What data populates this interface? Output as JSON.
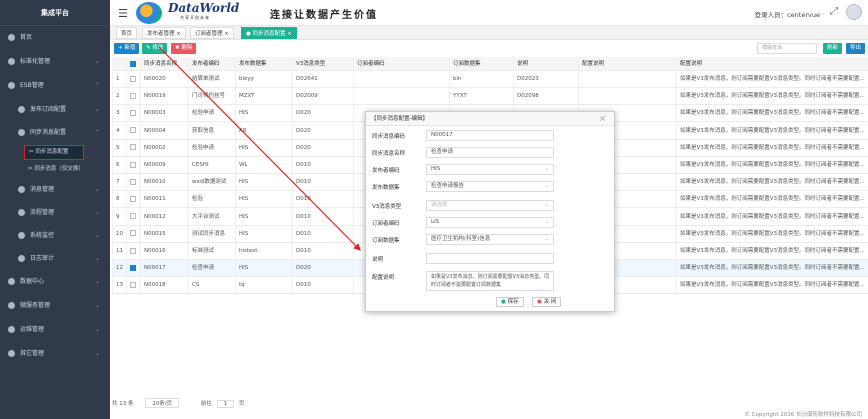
{
  "sidebar": {
    "title": "集成平台",
    "items": [
      {
        "label": "首页"
      },
      {
        "label": "标准化管理"
      },
      {
        "label": "ESB管理"
      },
      {
        "label": "发布订阅配置"
      },
      {
        "label": "同步消息配置"
      },
      {
        "label": "同步消息配置"
      },
      {
        "label": "同步消息（仅交换）"
      },
      {
        "label": "消息管理"
      },
      {
        "label": "流程管理"
      },
      {
        "label": "系统监控"
      },
      {
        "label": "日志审计"
      },
      {
        "label": "数据中心"
      },
      {
        "label": "微服务管理"
      },
      {
        "label": "运维管理"
      },
      {
        "label": "其它管理"
      }
    ]
  },
  "header": {
    "logo_text": "DataWorld",
    "logo_sub": "共享开创未来",
    "slogan": "连接让数据产生价值",
    "login_label": "登录人员：centervue"
  },
  "tabs": [
    {
      "label": "首页"
    },
    {
      "label": "发布者管理 ×"
    },
    {
      "label": "订阅者管理 ×"
    },
    {
      "label": "● 同步消息配置 ×"
    }
  ],
  "toolbar": {
    "new": "+ 新增",
    "edit": "✎ 修改",
    "delete": "✖ 删除",
    "search_placeholder": "模糊查询",
    "refresh": "刷新",
    "export": "导出"
  },
  "table": {
    "headers": [
      "",
      "同步消息编码",
      "同步消息名称",
      "发布者编码",
      "发布数据集",
      "V3消息类型",
      "订阅者编码",
      "订阅数据集",
      "说明",
      "配置说明"
    ],
    "rows": [
      [
        "1",
        "N00020",
        "结算单测试",
        "bleyy",
        "D02641",
        "",
        "bln",
        "D02023",
        "",
        "如果是V3发布消息，则订阅需要配置V3消息类型。同时订阅者不需要配置..."
      ],
      [
        "2",
        "N00019",
        "门诊预约挂号",
        "MZXT",
        "D02009",
        "",
        "YYXT",
        "D02098",
        "",
        "如果是V3发布消息，则订阅需要配置V3消息类型。同时订阅者不需要配置..."
      ],
      [
        "3",
        "N00003",
        "检验申请",
        "HIS",
        "D020",
        "",
        "",
        "",
        "",
        "如果是V3发布消息，则订阅需要配置V3消息类型。同时订阅者不需要配置..."
      ],
      [
        "4",
        "N00004",
        "获取信息",
        "AR",
        "D020",
        "",
        "",
        "",
        "",
        "如果是V3发布消息，则订阅需要配置V3消息类型。同时订阅者不需要配置..."
      ],
      [
        "5",
        "N00002",
        "检验申请",
        "HIS",
        "D020",
        "",
        "",
        "",
        "",
        "如果是V3发布消息，则订阅需要配置V3消息类型。同时订阅者不需要配置..."
      ],
      [
        "6",
        "N00009",
        "CESHI",
        "WL",
        "D010",
        "",
        "",
        "",
        "",
        "如果是V3发布消息，则订阅需要配置V3消息类型。同时订阅者不需要配置..."
      ],
      [
        "7",
        "N00010",
        "wsdl数据测试",
        "HIS",
        "D010",
        "",
        "",
        "",
        "",
        "如果是V3发布消息，则订阅需要配置V3消息类型。同时订阅者不需要配置..."
      ],
      [
        "8",
        "N00011",
        "检验",
        "HIS",
        "D010",
        "",
        "",
        "",
        "",
        "如果是V3发布消息，则订阅需要配置V3消息类型。同时订阅者不需要配置..."
      ],
      [
        "9",
        "N00012",
        "大平台测试",
        "HIS",
        "D010",
        "",
        "",
        "",
        "",
        "如果是V3发布消息，则订阅需要配置V3消息类型。同时订阅者不需要配置..."
      ],
      [
        "10",
        "N00015",
        "测试同步消息",
        "HIS",
        "D010",
        "",
        "",
        "",
        "",
        "如果是V3发布消息，则订阅需要配置V3消息类型。同时订阅者不需要配置..."
      ],
      [
        "11",
        "N00016",
        "标准测试",
        "histest",
        "D010",
        "",
        "",
        "",
        "",
        "如果是V3发布消息，则订阅需要配置V3消息类型。同时订阅者不需要配置..."
      ],
      [
        "12",
        "N00017",
        "检查申请",
        "HIS",
        "D020",
        "",
        "",
        "",
        "",
        "如果是V3发布消息，则订阅需要配置V3消息类型。同时订阅者不需要配置..."
      ],
      [
        "13",
        "N00018",
        "CS",
        "tq",
        "D010",
        "",
        "",
        "",
        "",
        "如果是V3发布消息，则订阅需要配置V3消息类型。同时订阅者不需要配置..."
      ]
    ]
  },
  "pager": {
    "total": "共 13 条",
    "page_size": "20条/页",
    "goto_label": "前往",
    "page": "1",
    "page_suffix": "页"
  },
  "copyright": "© Copyright 2016 长沙康历软件科技有限公司",
  "modal": {
    "title": "【同步消息配置-编辑】",
    "fields": [
      {
        "label": "同步消息编码",
        "value": "N00017"
      },
      {
        "label": "同步消息名称",
        "value": "检查申请"
      },
      {
        "label": "发布者编码",
        "value": "HIS"
      },
      {
        "label": "发布数据集",
        "value": "检查申请报告"
      },
      {
        "label": "V3消息类型",
        "value": "请选择"
      },
      {
        "label": "订阅者编码",
        "value": "LIS"
      },
      {
        "label": "订阅数据集",
        "value": "医疗卫生机构(科室)信息"
      },
      {
        "label": "说明",
        "value": ""
      },
      {
        "label": "配置说明",
        "value": "如果是V3发布消息，则订阅需要配置V3消息类型。同时订阅者不需要配置订阅数据集"
      }
    ],
    "save": "保存",
    "close": "关 闭"
  },
  "colors": {
    "sidebar_bg": "#2f3a4b",
    "accent_green": "#1ab394",
    "accent_blue": "#1c84c6",
    "accent_red": "#ed5565",
    "annotation_red": "#e02020"
  }
}
